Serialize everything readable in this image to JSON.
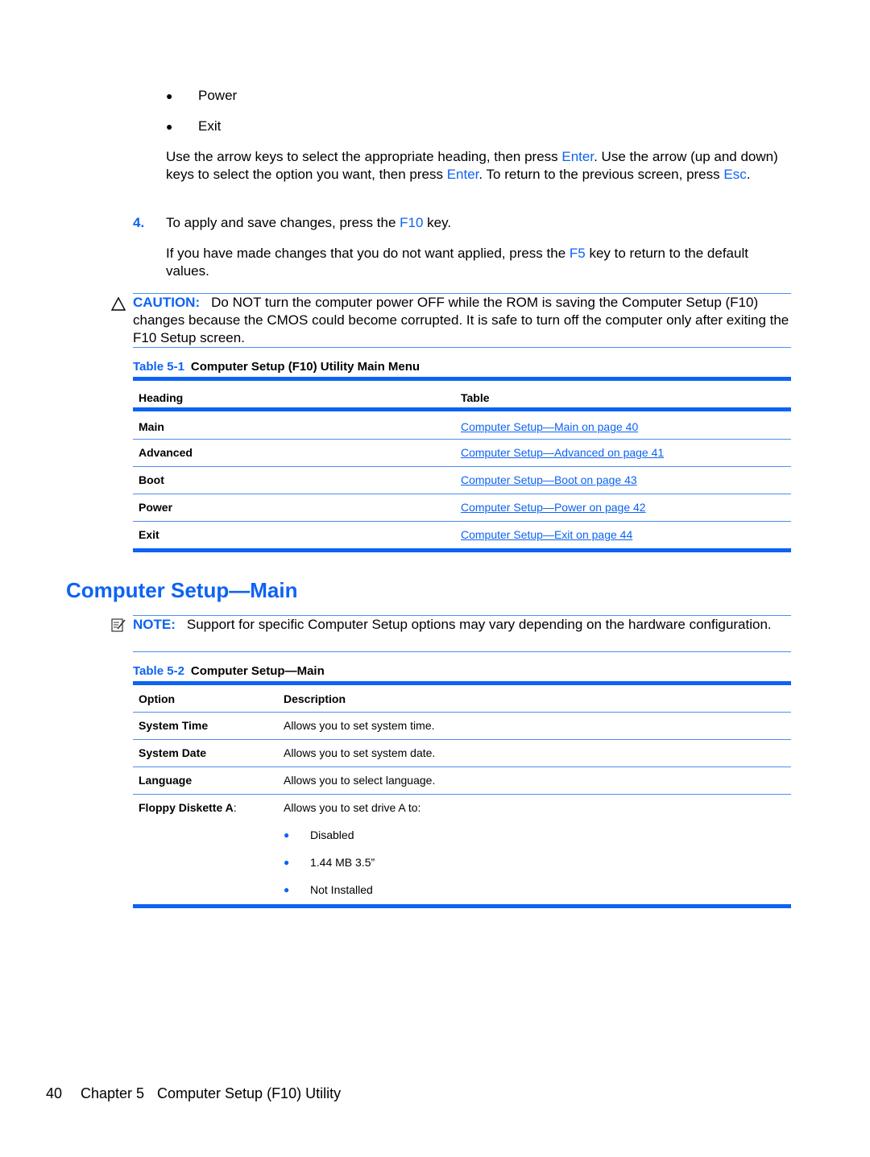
{
  "intro_bullets": [
    "Power",
    "Exit"
  ],
  "nav_paragraph": {
    "p1": "Use the arrow keys to select the appropriate heading, then press ",
    "k1": "Enter",
    "p2": ". Use the arrow (up and down) keys to select the option you want, then press ",
    "k2": "Enter",
    "p3": ". To return to the previous screen, press ",
    "k3": "Esc",
    "p4": "."
  },
  "step4": {
    "number": "4.",
    "p1": "To apply and save changes, press the ",
    "key": "F10",
    "p2": " key."
  },
  "revert_paragraph": {
    "p1": "If you have made changes that you do not want applied, press the ",
    "key": "F5",
    "p2": " key to return to the default values."
  },
  "caution": {
    "label": "CAUTION:",
    "text": "Do NOT turn the computer power OFF while the ROM is saving the Computer Setup (F10) changes because the CMOS could become corrupted. It is safe to turn off the computer only after exiting the F10 Setup screen."
  },
  "table1": {
    "caption_number": "Table 5-1",
    "caption_title": "Computer Setup (F10) Utility Main Menu",
    "headers": [
      "Heading",
      "Table"
    ],
    "rows": [
      {
        "heading": "Main",
        "link": "Computer Setup—Main on page 40"
      },
      {
        "heading": "Advanced",
        "link": "Computer Setup—Advanced on page 41"
      },
      {
        "heading": "Boot",
        "link": "Computer Setup—Boot on page 43"
      },
      {
        "heading": "Power",
        "link": "Computer Setup—Power on page 42"
      },
      {
        "heading": "Exit",
        "link": "Computer Setup—Exit on page 44"
      }
    ]
  },
  "section_title": "Computer Setup—Main",
  "note": {
    "label": "NOTE:",
    "text": "Support for specific Computer Setup options may vary depending on the hardware configuration."
  },
  "table2": {
    "caption_number": "Table 5-2",
    "caption_title": "Computer Setup—Main",
    "headers": [
      "Option",
      "Description"
    ],
    "rows": [
      {
        "option": "System Time",
        "description": "Allows you to set system time."
      },
      {
        "option": "System Date",
        "description": "Allows you to set system date."
      },
      {
        "option": "Language",
        "description": "Allows you to select language."
      },
      {
        "option": "Floppy Diskette A",
        "option_suffix": ":",
        "description": "Allows you to set drive A to:",
        "choices": [
          "Disabled",
          "1.44 MB 3.5”",
          "Not Installed"
        ]
      }
    ]
  },
  "footer": {
    "page_number": "40",
    "chapter": "Chapter 5",
    "chapter_title": "Computer Setup (F10) Utility"
  },
  "colors": {
    "accent": "#0d63f3",
    "rule": "#4a8ef5"
  }
}
